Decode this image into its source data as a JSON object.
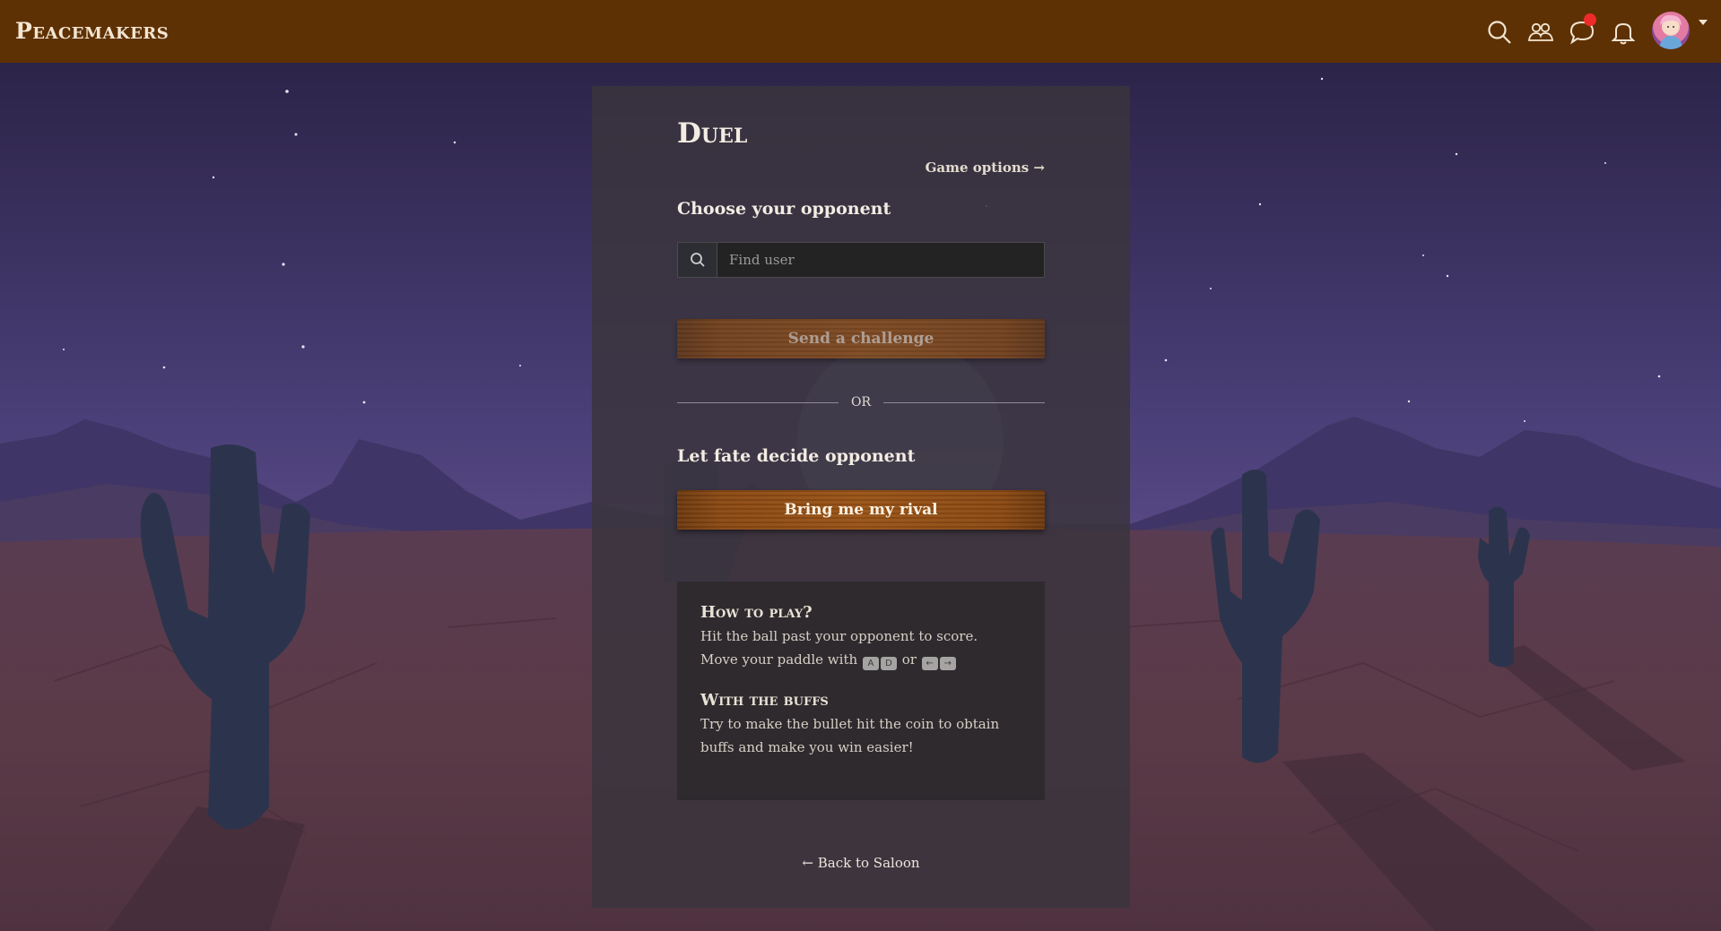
{
  "app": {
    "brand": "Peacemakers",
    "nav_icons": [
      "search-icon",
      "friends-icon",
      "chat-icon",
      "bell-icon"
    ],
    "has_chat_notification": true,
    "colors": {
      "topbar": "#5e3104",
      "notification": "#ee2b2b",
      "plank": "#9a5417"
    }
  },
  "duel": {
    "title": "Duel",
    "game_options_label": "Game options →",
    "choose_label": "Choose your opponent",
    "search_placeholder": "Find user",
    "send_challenge_label": "Send a challenge",
    "or_label": "OR",
    "fate_label": "Let fate decide opponent",
    "rival_label": "Bring me my rival",
    "back_label": "← Back to Saloon"
  },
  "howto": {
    "title": "How to play?",
    "line1": "Hit the ball past your opponent to score.",
    "paddle_prefix": "Move your paddle with",
    "key_a": "A",
    "key_d": "D",
    "or_word": "or",
    "key_left": "←",
    "key_right": "→",
    "buffs_title": "With the buffs",
    "buffs_text": "Try to make the bullet hit the coin to obtain buffs and make you win easier!"
  }
}
